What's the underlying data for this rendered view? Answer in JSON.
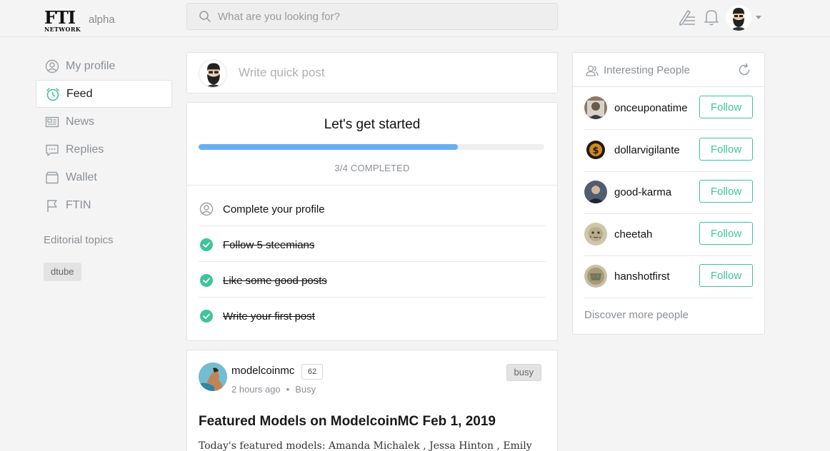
{
  "header": {
    "logo_main": "FTI",
    "logo_sub": "NETWORK",
    "edition": "alpha",
    "search_placeholder": "What are you looking for?"
  },
  "sidebar": {
    "items": [
      {
        "label": "My profile",
        "icon": "user-circle-icon",
        "active": false
      },
      {
        "label": "Feed",
        "icon": "clock-icon",
        "active": true
      },
      {
        "label": "News",
        "icon": "newspaper-icon",
        "active": false
      },
      {
        "label": "Replies",
        "icon": "chat-bubble-icon",
        "active": false
      },
      {
        "label": "Wallet",
        "icon": "wallet-icon",
        "active": false
      },
      {
        "label": "FTIN",
        "icon": "flag-icon",
        "active": false
      }
    ],
    "editorial_title": "Editorial topics",
    "topics": [
      "dtube"
    ]
  },
  "quick_post": {
    "placeholder": "Write quick post"
  },
  "getting_started": {
    "title": "Let's get started",
    "progress": 0.75,
    "completed_label": "3/4 COMPLETED",
    "tasks": [
      {
        "label": "Complete your profile",
        "done": false
      },
      {
        "label": "Follow 5 steemians",
        "done": true
      },
      {
        "label": "Like some good posts",
        "done": true
      },
      {
        "label": "Write your first post",
        "done": true
      }
    ]
  },
  "post": {
    "author": "modelcoinmc",
    "reputation": "62",
    "time": "2 hours ago",
    "app": "Busy",
    "tag": "busy",
    "title": "Featured Models on ModelcoinMC Feb 1, 2019",
    "excerpt": "Today's featured models: Amanda Michalek , Jessa Hinton , Emily"
  },
  "interesting_people": {
    "title": "Interesting People",
    "follow_label": "Follow",
    "people": [
      {
        "name": "onceuponatime",
        "color": "#6b5a4e"
      },
      {
        "name": "dollarvigilante",
        "color": "#1e1a14"
      },
      {
        "name": "good-karma",
        "color": "#3d4a5c"
      },
      {
        "name": "cheetah",
        "color": "#b8ae8c"
      },
      {
        "name": "hanshotfirst",
        "color": "#a89a78"
      }
    ],
    "discover_label": "Discover more people"
  },
  "colors": {
    "accent_green": "#3ec49b",
    "progress_blue": "#6aaef2"
  }
}
